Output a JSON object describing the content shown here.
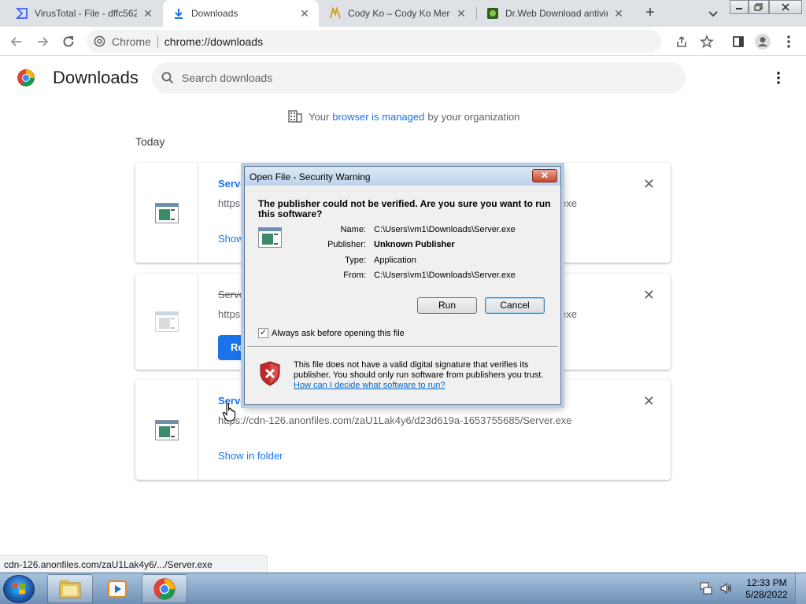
{
  "tabs": [
    {
      "title": "VirusTotal - File - dffc562",
      "icon": "virustotal-icon"
    },
    {
      "title": "Downloads",
      "icon": "download-icon"
    },
    {
      "title": "Cody Ko – Cody Ko Merch",
      "icon": "ko-icon"
    },
    {
      "title": "Dr.Web Download antivirus",
      "icon": "drweb-icon"
    }
  ],
  "toolbar": {
    "omnibox_label": "Chrome",
    "url": "chrome://downloads"
  },
  "downloads": {
    "title": "Downloads",
    "search_placeholder": "Search downloads",
    "managed_prefix": "Your",
    "managed_link": "browser is managed",
    "managed_suffix": "by your organization",
    "section": "Today",
    "items": [
      {
        "name": "Serve",
        "url": "https:",
        "url_tail": "exe",
        "action": "Show"
      },
      {
        "name": "Serve",
        "url": "https:",
        "url_tail": "exe",
        "action": "Res"
      },
      {
        "name": "Serve",
        "url": "https://cdn-126.anonfiles.com/zaU1Lak4y6/d23d619a-1653755685/Server.exe",
        "action": "Show in folder"
      }
    ]
  },
  "status_url": "cdn-126.anonfiles.com/zaU1Lak4y6/.../Server.exe",
  "dialog": {
    "title": "Open File - Security Warning",
    "question": "The publisher could not be verified.  Are you sure you want to run this software?",
    "fields": [
      {
        "label": "Name:",
        "value": "C:\\Users\\vm1\\Downloads\\Server.exe"
      },
      {
        "label": "Publisher:",
        "value": "Unknown Publisher"
      },
      {
        "label": "Type:",
        "value": "Application"
      },
      {
        "label": "From:",
        "value": "C:\\Users\\vm1\\Downloads\\Server.exe"
      }
    ],
    "run_label": "Run",
    "cancel_label": "Cancel",
    "checkbox_label": "Always ask before opening this file",
    "checkbox_checked": true,
    "warning_text": "This file does not have a valid digital signature that verifies its publisher.  You should only run software from publishers you trust.",
    "help_link": "How can I decide what software to run?"
  },
  "taskbar": {
    "time": "12:33 PM",
    "date": "5/28/2022"
  },
  "colors": {
    "accent": "#1a73e8",
    "danger": "#d32f2f"
  }
}
